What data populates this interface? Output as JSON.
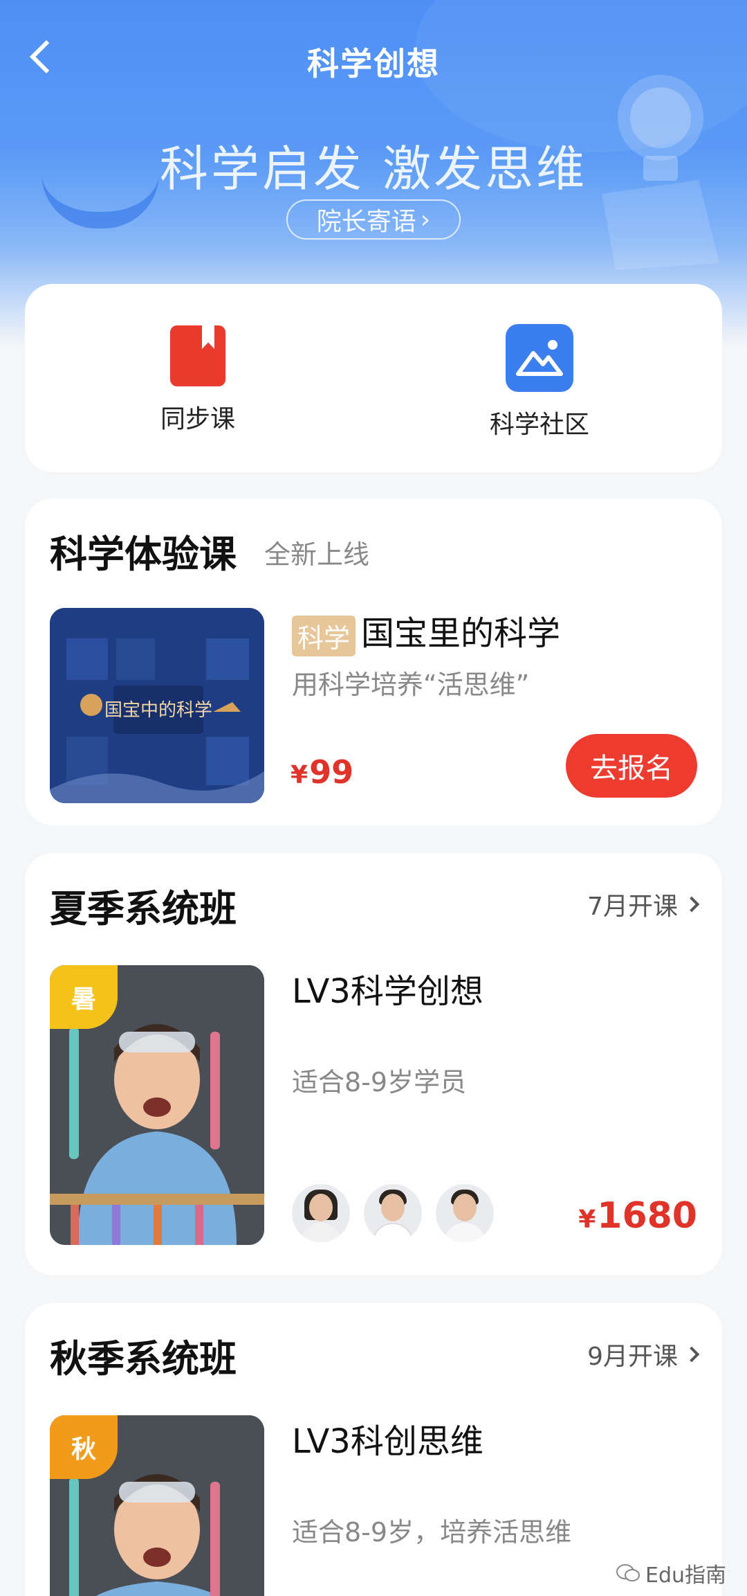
{
  "header": {
    "title": "科学创想",
    "slogan": "科学启发 激发思维",
    "pill_label": "院长寄语",
    "pill_arrow": "›"
  },
  "shortcuts": [
    {
      "label": "同步课",
      "icon": "bookmark-book-icon"
    },
    {
      "label": "科学社区",
      "icon": "gallery-image-icon"
    }
  ],
  "trial": {
    "title": "科学体验课",
    "subtitle": "全新上线",
    "course": {
      "tag": "科学",
      "name": "国宝里的科学",
      "desc": "用科学培养“活思维”",
      "currency": "¥",
      "price": "99",
      "button": "去报名",
      "thumb_text": "国宝中的科学"
    }
  },
  "summer": {
    "title": "夏季系统班",
    "more": "7月开课",
    "course": {
      "corner": "暑",
      "name": "LV3科学创想",
      "desc": "适合8-9岁学员",
      "currency": "¥",
      "price": "1680"
    },
    "teachers": [
      "teacher-avatar-female",
      "teacher-avatar-male",
      "teacher-avatar-male-2"
    ]
  },
  "autumn": {
    "title": "秋季系统班",
    "more": "9月开课",
    "course": {
      "corner": "秋",
      "name": "LV3科创思维",
      "desc": "适合8-9岁，培养活思维"
    }
  },
  "watermark": "Edu指南",
  "colors": {
    "accent_red": "#ee3b2f",
    "price_red": "#e0332a",
    "header_blue": "#4d8ff5",
    "tag_gold": "#e7c69a",
    "summer_corner": "#f5c21a",
    "autumn_corner": "#f29a1a"
  }
}
